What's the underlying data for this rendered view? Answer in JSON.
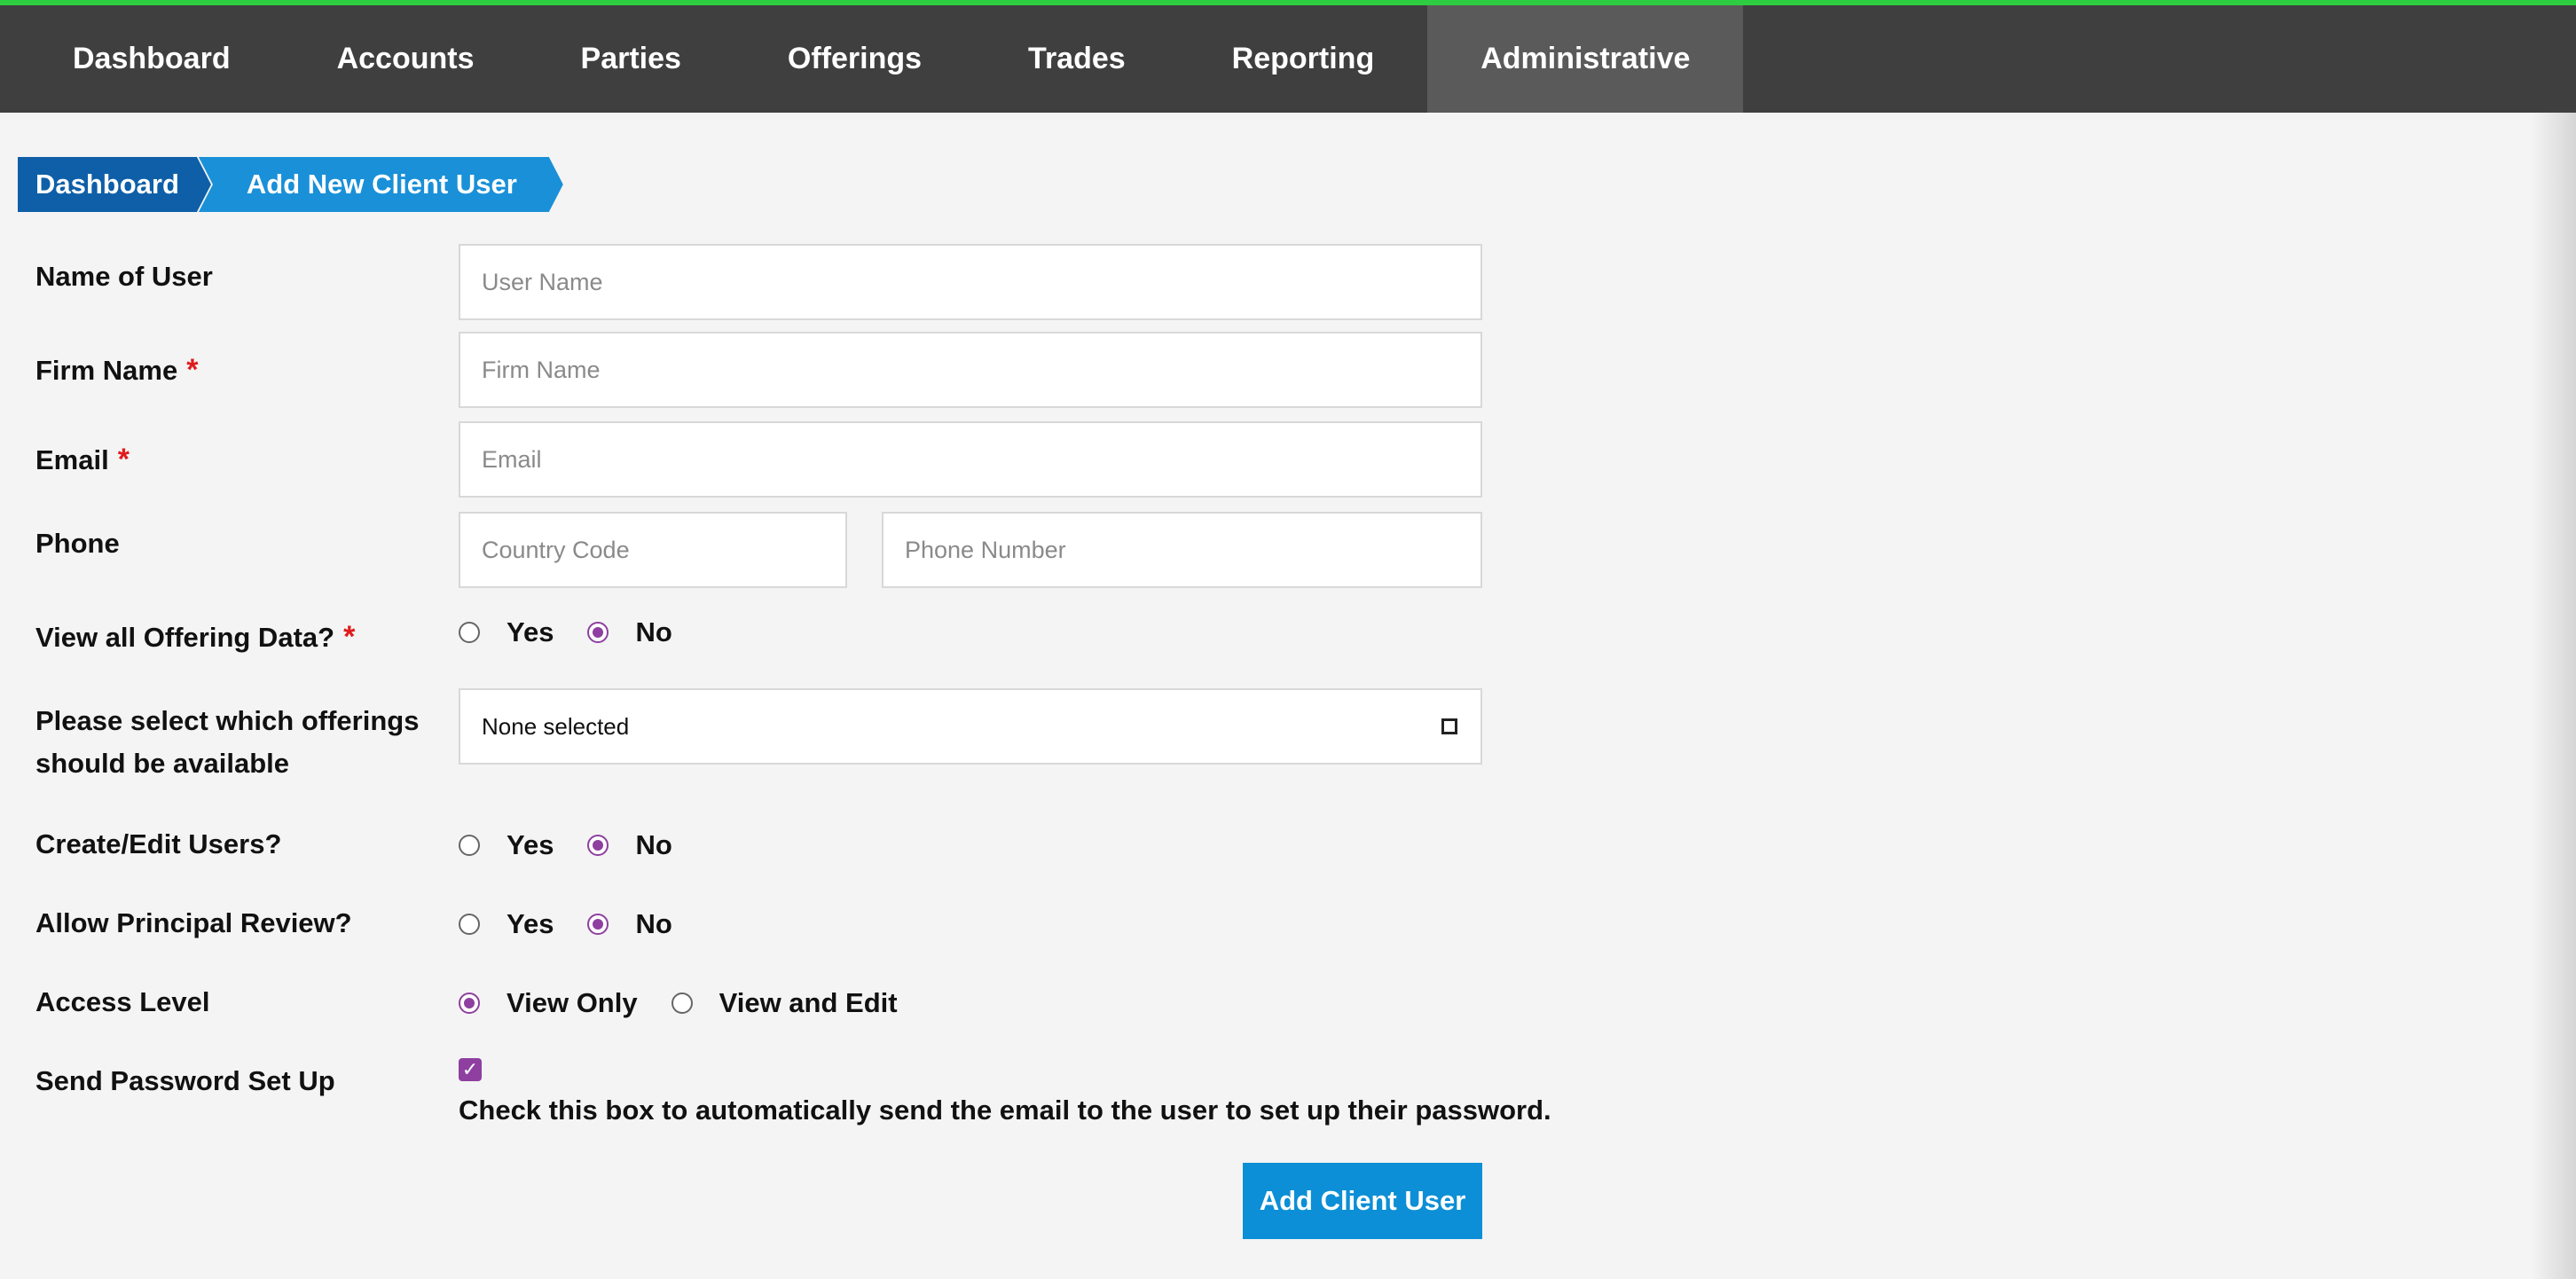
{
  "nav": {
    "items": [
      {
        "label": "Dashboard"
      },
      {
        "label": "Accounts"
      },
      {
        "label": "Parties"
      },
      {
        "label": "Offerings"
      },
      {
        "label": "Trades"
      },
      {
        "label": "Reporting"
      },
      {
        "label": "Administrative",
        "active": true
      }
    ]
  },
  "breadcrumb": {
    "root": "Dashboard",
    "current": "Add New Client User"
  },
  "form": {
    "name_of_user": {
      "label": "Name of User",
      "placeholder": "User Name",
      "value": ""
    },
    "firm_name": {
      "label": "Firm Name",
      "required_mark": "*",
      "placeholder": "Firm Name",
      "value": ""
    },
    "email": {
      "label": "Email",
      "required_mark": "*",
      "placeholder": "Email",
      "value": ""
    },
    "phone": {
      "label": "Phone",
      "country_code_placeholder": "Country Code",
      "phone_number_placeholder": "Phone Number"
    },
    "view_all_offering_data": {
      "label": "View all Offering Data?",
      "required_mark": "*",
      "yes_label": "Yes",
      "no_label": "No",
      "selected": "No"
    },
    "offerings": {
      "label_line1": "Please select which offerings",
      "label_line2": "should be available",
      "selected_text": "None selected"
    },
    "create_edit_users": {
      "label": "Create/Edit Users?",
      "yes_label": "Yes",
      "no_label": "No",
      "selected": "No"
    },
    "allow_principal_review": {
      "label": "Allow Principal Review?",
      "yes_label": "Yes",
      "no_label": "No",
      "selected": "No"
    },
    "access_level": {
      "label": "Access Level",
      "option1": "View Only",
      "option2": "View and Edit",
      "selected": "View Only"
    },
    "send_password_setup": {
      "label": "Send Password Set Up",
      "checked": true,
      "checkmark": "✓",
      "help_text": "Check this box to automatically send the email to the user to set up their password."
    },
    "submit_label": "Add Client User"
  },
  "colors": {
    "nav_bg": "#3f3f3f",
    "nav_active_bg": "#5a5a5a",
    "top_accent": "#2ecc40",
    "breadcrumb_root": "#0e5fa8",
    "breadcrumb_current": "#1a90d8",
    "radio_checked": "#8e3fa0",
    "required": "#e01b1b",
    "submit_bg": "#0c8fd6"
  }
}
